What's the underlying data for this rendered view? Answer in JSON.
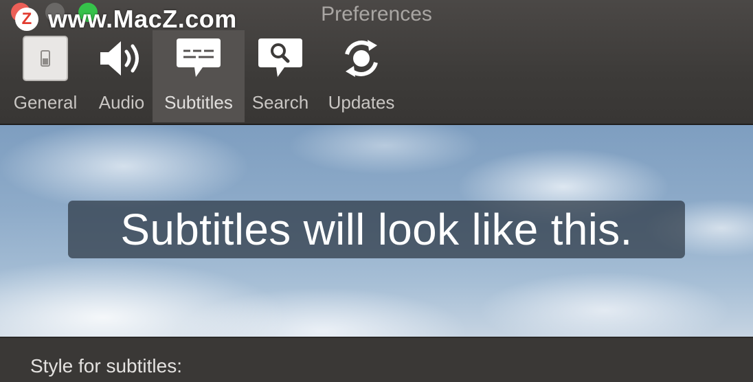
{
  "window": {
    "title": "Preferences"
  },
  "watermark": {
    "logo_letter": "Z",
    "text": "www.MacZ.com"
  },
  "toolbar": {
    "items": [
      {
        "label": "General",
        "icon": "switch-icon",
        "selected": false
      },
      {
        "label": "Audio",
        "icon": "speaker-icon",
        "selected": false
      },
      {
        "label": "Subtitles",
        "icon": "subtitles-bubble-icon",
        "selected": true
      },
      {
        "label": "Search",
        "icon": "search-bubble-icon",
        "selected": false
      },
      {
        "label": "Updates",
        "icon": "refresh-icon",
        "selected": false
      }
    ]
  },
  "preview": {
    "subtitle_text": "Subtitles will look like this."
  },
  "settings": {
    "style_label": "Style for subtitles:"
  },
  "colors": {
    "close": "#ec5f57",
    "minimize": "#6a6866",
    "zoom": "#35c24a",
    "toolbar_bg": "#3d3b39",
    "selected_tab": "#555250"
  }
}
